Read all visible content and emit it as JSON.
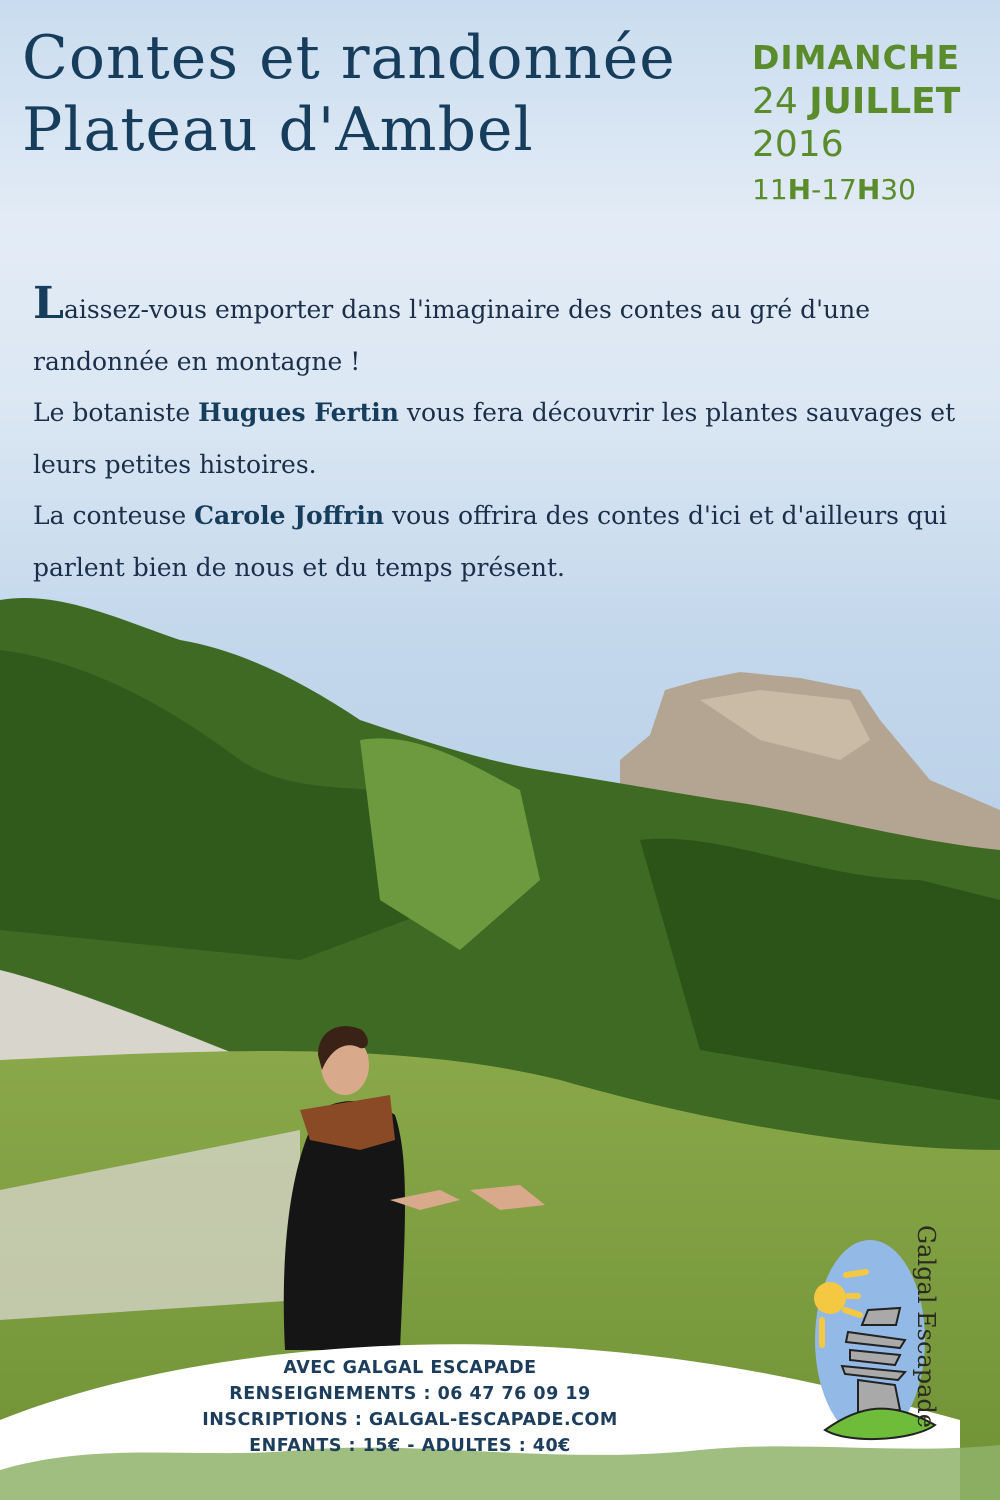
{
  "title": {
    "line1": "Contes et randonnée",
    "line2": "Plateau d'Ambel"
  },
  "date": {
    "day": "DIMANCHE",
    "day_num": "24",
    "month": "JUILLET",
    "year": "2016",
    "time_start_h": "11",
    "time_h1": "H",
    "time_sep": "-",
    "time_end_h": "17",
    "time_h2": "H",
    "time_end_m": "30"
  },
  "description": {
    "drop_cap": "L",
    "p1": "aissez-vous emporter dans l'imaginaire des contes au gré d'une randonnée en montagne !",
    "p2_pre": "Le botaniste ",
    "p2_name": "Hugues Fertin",
    "p2_post": " vous fera découvrir les plantes sauvages et leurs petites histoires.",
    "p3_pre": "La conteuse ",
    "p3_name": "Carole Joffrin",
    "p3_post": " vous offrira des contes d'ici et d'ailleurs qui parlent bien de nous et du temps présent."
  },
  "footer": {
    "line1": "AVEC GALGAL ESCAPADE",
    "line2": "RENSEIGNEMENTS : 06 47 76 09 19",
    "line3": "INSCRIPTIONS : GALGAL-ESCAPADE.COM",
    "line4": "ENFANTS : 15€ - ADULTES : 40€"
  },
  "logo": {
    "text": "Galgal Escapade"
  },
  "colors": {
    "title": "#173d5c",
    "accent_green": "#5a8c2c"
  }
}
